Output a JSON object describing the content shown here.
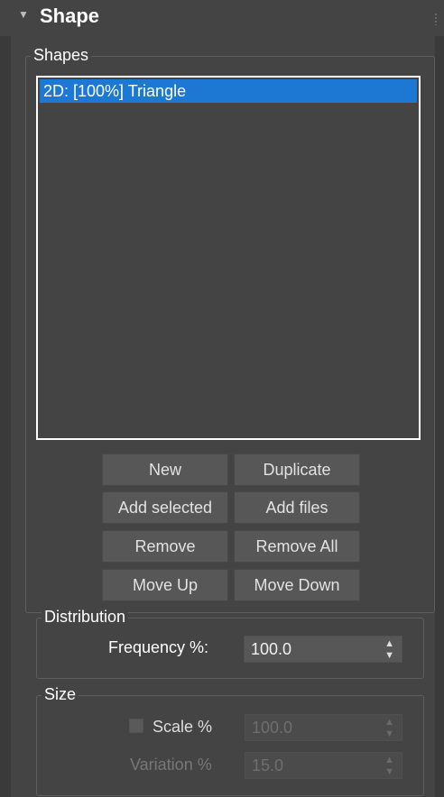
{
  "rollout": {
    "title": "Shape",
    "arrow": "▼"
  },
  "shapes": {
    "group_label": "Shapes",
    "items": [
      {
        "label": "2D: [100%] Triangle",
        "selected": true
      }
    ]
  },
  "buttons": {
    "new": "New",
    "duplicate": "Duplicate",
    "add_selected": "Add selected",
    "add_files": "Add files",
    "remove": "Remove",
    "remove_all": "Remove All",
    "move_up": "Move Up",
    "move_down": "Move Down"
  },
  "distribution": {
    "group_label": "Distribution",
    "frequency_label": "Frequency %:",
    "frequency_value": "100.0"
  },
  "size": {
    "group_label": "Size",
    "scale_label": "Scale %",
    "scale_checked": false,
    "scale_value": "100.0",
    "variation_label": "Variation %",
    "variation_value": "15.0"
  },
  "colors": {
    "background": "#444444",
    "selection": "#1c78d2",
    "button": "#575757"
  }
}
